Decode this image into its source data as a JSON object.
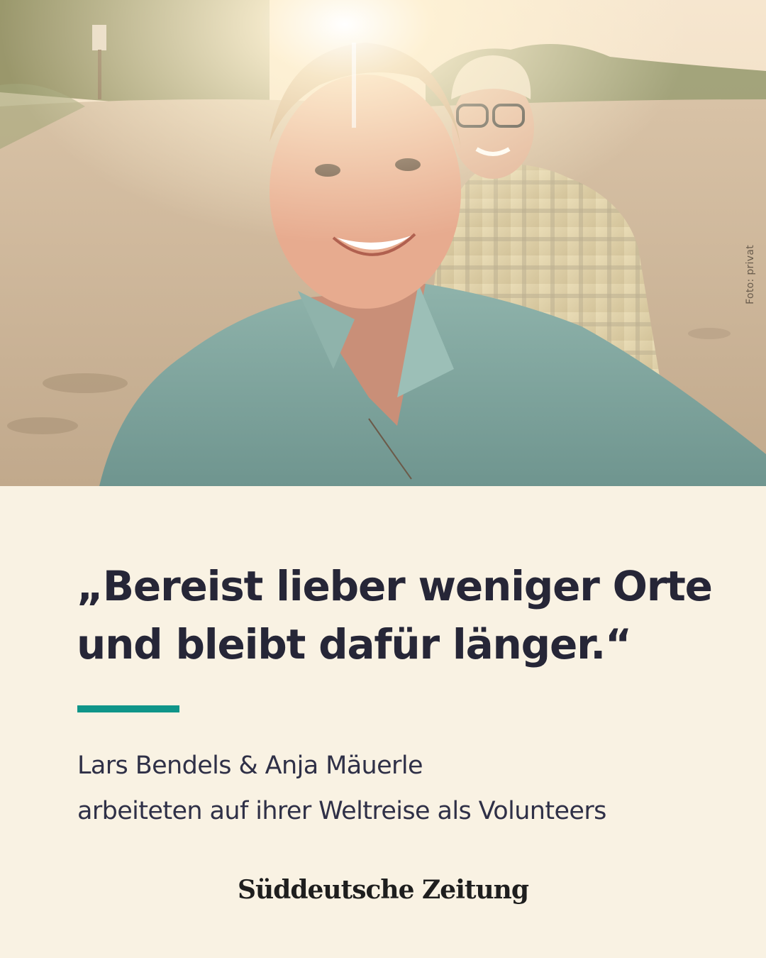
{
  "photo": {
    "credit": "Foto: privat"
  },
  "quote": {
    "line1": "„Bereist lieber weniger Orte",
    "line2": "und bleibt dafür länger.“"
  },
  "attribution": {
    "names": "Lars Bendels & Anja Mäuerle",
    "caption": "arbeiteten auf ihrer Weltreise als Volunteers"
  },
  "brand": {
    "logo_text": "Süddeutsche Zeitung",
    "accent_color": "#0f9589",
    "background_color": "#f9f2e3",
    "text_color": "#262637"
  }
}
